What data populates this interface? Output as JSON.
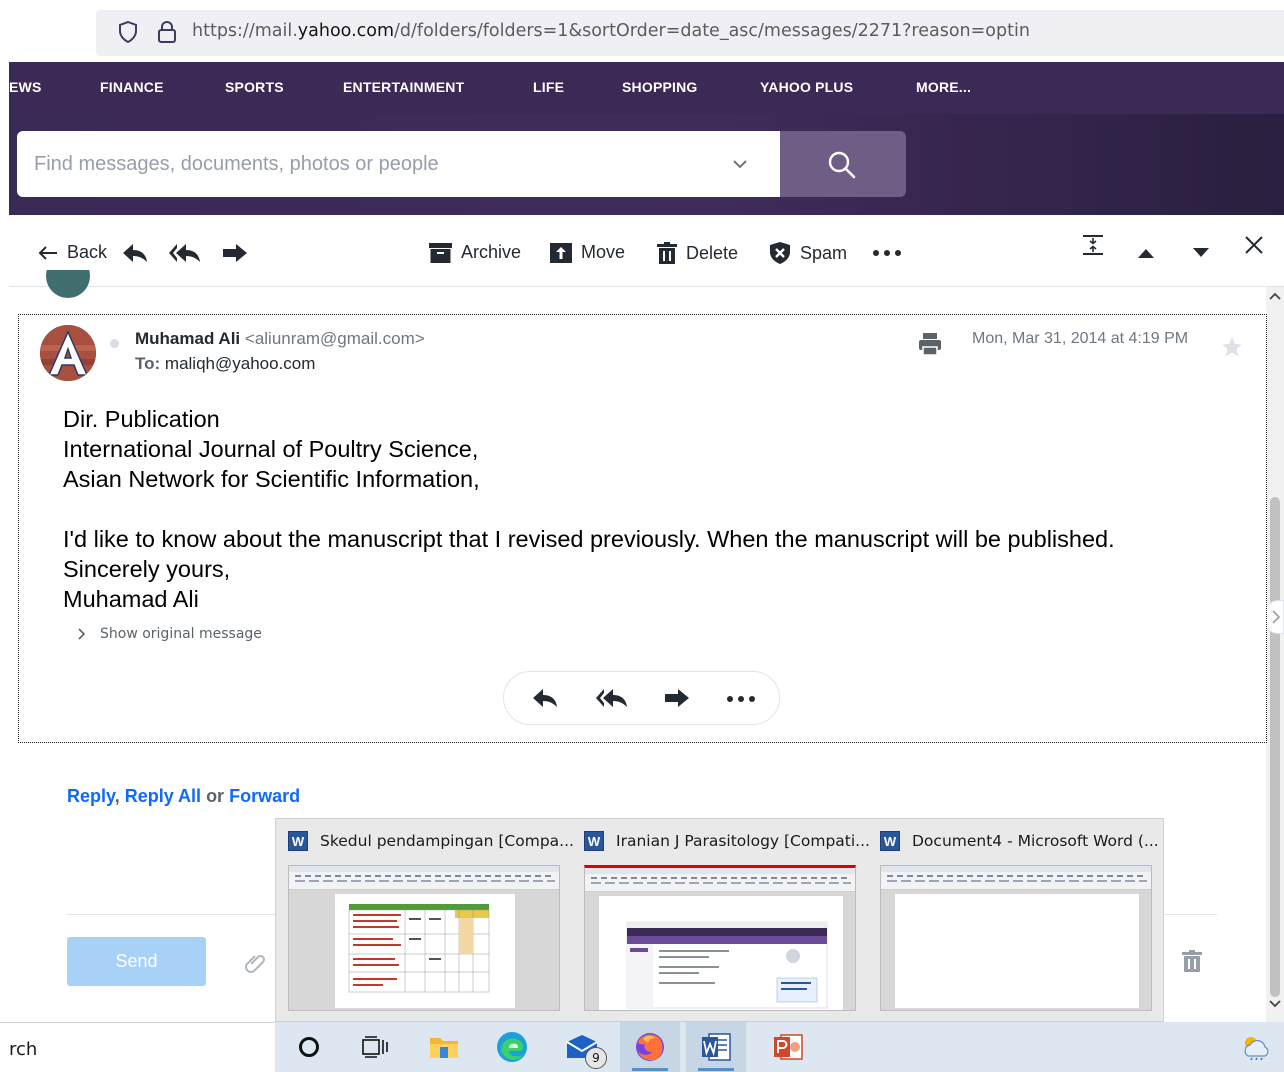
{
  "browser": {
    "url_prefix": "https://mail.",
    "url_domain": "yahoo.com",
    "url_suffix": "/d/folders/folders=1&sortOrder=date_asc/messages/2271?reason=optin"
  },
  "nav": {
    "items": [
      "EWS",
      "FINANCE",
      "SPORTS",
      "ENTERTAINMENT",
      "LIFE",
      "SHOPPING",
      "YAHOO PLUS",
      "MORE..."
    ]
  },
  "search": {
    "placeholder": "Find messages, documents, photos or people"
  },
  "toolbar": {
    "back": "Back",
    "archive": "Archive",
    "move": "Move",
    "delete": "Delete",
    "spam": "Spam"
  },
  "message": {
    "sender_name": "Muhamad Ali",
    "sender_email": "<aliunram@gmail.com>",
    "to_label": "To:",
    "to_address": "maliqh@yahoo.com",
    "date": "Mon, Mar 31, 2014 at 4:19 PM",
    "body_lines": [
      "Dir. Publication",
      "International Journal of Poultry Science,",
      "Asian Network for Scientific Information,",
      "",
      "I'd like to know about the manuscript that I revised previously. When the manuscript will be published.",
      "Sincerely yours,",
      "Muhamad Ali"
    ],
    "show_original": "Show original message"
  },
  "reply_line": {
    "reply": "Reply",
    "sep1": ", ",
    "reply_all": "Reply All",
    "or": " or ",
    "forward": "Forward"
  },
  "composer": {
    "send": "Send"
  },
  "previews": [
    {
      "title": "Skedul pendampingan [Compa..."
    },
    {
      "title": "Iranian J Parasitology [Compati..."
    },
    {
      "title": "Document4 - Microsoft Word (..."
    }
  ],
  "taskbar": {
    "search_text": "rch",
    "mail_badge": "9"
  },
  "colors": {
    "nav_bg": "#3b2a56",
    "link_blue": "#0f69ff",
    "send_disabled": "#a8d1f7"
  }
}
